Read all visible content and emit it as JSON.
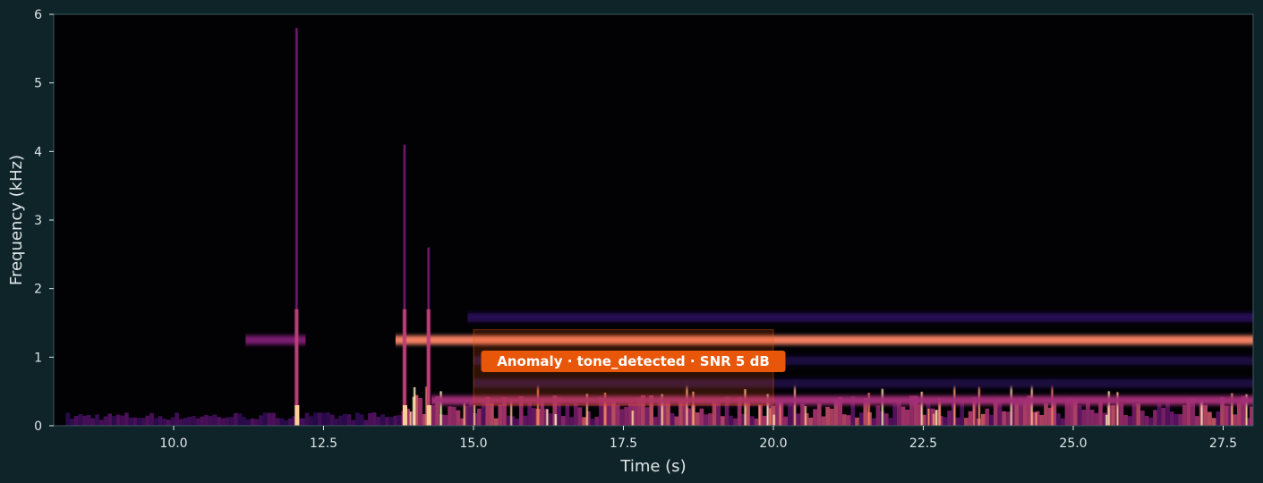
{
  "chart_data": {
    "type": "heatmap",
    "subtype": "spectrogram",
    "title": "",
    "xlabel": "Time (s)",
    "ylabel": "Frequency (kHz)",
    "xlim": [
      8.0,
      28.0
    ],
    "ylim": [
      0,
      6
    ],
    "x_ticks": [
      "10.0",
      "12.5",
      "15.0",
      "17.5",
      "20.0",
      "22.5",
      "25.0",
      "27.5"
    ],
    "y_ticks": [
      "0",
      "1",
      "2",
      "3",
      "4",
      "5",
      "6"
    ],
    "colormap": "magma",
    "grid": false,
    "tonal_bands": [
      {
        "freq_khz": 1.25,
        "start_s": 11.2,
        "end_s": 12.2,
        "level": 0.45
      },
      {
        "freq_khz": 1.25,
        "start_s": 13.7,
        "end_s": 28.0,
        "level": 0.78
      },
      {
        "freq_khz": 0.37,
        "start_s": 14.3,
        "end_s": 28.0,
        "level": 0.55
      },
      {
        "freq_khz": 1.58,
        "start_s": 14.9,
        "end_s": 28.0,
        "level": 0.2
      },
      {
        "freq_khz": 0.95,
        "start_s": 15.0,
        "end_s": 28.0,
        "level": 0.15
      },
      {
        "freq_khz": 0.62,
        "start_s": 15.0,
        "end_s": 28.0,
        "level": 0.15
      }
    ],
    "transients_s": [
      12.05,
      13.85,
      14.25
    ],
    "anomaly": {
      "label": "Anomaly · tone_detected · SNR 5 dB",
      "start_s": 15.0,
      "end_s": 20.0,
      "freq_low_khz": 0.3,
      "freq_high_khz": 1.4,
      "color": "#e8560a"
    }
  },
  "colors": {
    "background": "#0f2429",
    "plot_area": "#020205",
    "text": "#dfe6e8",
    "frame": "#3b5a60"
  }
}
